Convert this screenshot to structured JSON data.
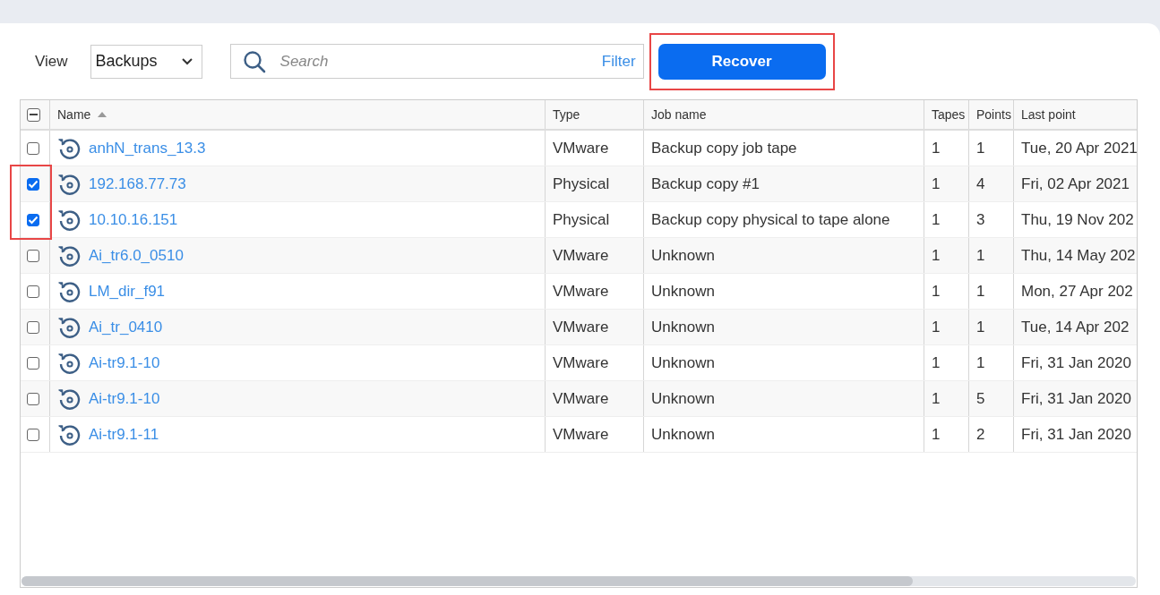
{
  "toolbar": {
    "view_label": "View",
    "view_select": "Backups",
    "search": {
      "placeholder": "Search"
    },
    "filter_link": "Filter",
    "recover_button": {
      "label": "Recover",
      "highlighted": true
    }
  },
  "table": {
    "select_all_partial": true,
    "columns": [
      {
        "label": "Name",
        "sorted_ascending": true
      },
      {
        "label": "Type",
        "sorted_ascending": false
      },
      {
        "label": "Job name",
        "sorted_ascending": false
      },
      {
        "label": "Tapes",
        "sorted_ascending": false
      },
      {
        "label": "Points",
        "sorted_ascending": false
      },
      {
        "label": "Last point",
        "sorted_ascending": false
      }
    ],
    "rows": [
      {
        "name": "anhN_trans_13.3",
        "type": "VMware",
        "job_name": "Backup copy job tape",
        "tapes": "1",
        "points": "1",
        "last_point": "Tue, 20 Apr 2021",
        "checked": false,
        "highlighted": false
      },
      {
        "name": "192.168.77.73",
        "type": "Physical",
        "job_name": "Backup copy #1",
        "tapes": "1",
        "points": "4",
        "last_point": "Fri, 02 Apr 2021",
        "checked": true,
        "highlighted": true
      },
      {
        "name": "10.10.16.151",
        "type": "Physical",
        "job_name": "Backup copy physical to tape alone",
        "tapes": "1",
        "points": "3",
        "last_point": "Thu, 19 Nov 202",
        "checked": true,
        "highlighted": true
      },
      {
        "name": "Ai_tr6.0_0510",
        "type": "VMware",
        "job_name": "Unknown",
        "tapes": "1",
        "points": "1",
        "last_point": "Thu, 14 May 202",
        "checked": false,
        "highlighted": false
      },
      {
        "name": "LM_dir_f91",
        "type": "VMware",
        "job_name": "Unknown",
        "tapes": "1",
        "points": "1",
        "last_point": "Mon, 27 Apr 202",
        "checked": false,
        "highlighted": false
      },
      {
        "name": "Ai_tr_0410",
        "type": "VMware",
        "job_name": "Unknown",
        "tapes": "1",
        "points": "1",
        "last_point": "Tue, 14 Apr 202",
        "checked": false,
        "highlighted": false
      },
      {
        "name": "Ai-tr9.1-10",
        "type": "VMware",
        "job_name": "Unknown",
        "tapes": "1",
        "points": "1",
        "last_point": "Fri, 31 Jan 2020",
        "checked": false,
        "highlighted": false
      },
      {
        "name": "Ai-tr9.1-10",
        "type": "VMware",
        "job_name": "Unknown",
        "tapes": "1",
        "points": "5",
        "last_point": "Fri, 31 Jan 2020",
        "checked": false,
        "highlighted": false
      },
      {
        "name": "Ai-tr9.1-11",
        "type": "VMware",
        "job_name": "Unknown",
        "tapes": "1",
        "points": "2",
        "last_point": "Fri, 31 Jan 2020",
        "checked": false,
        "highlighted": false
      }
    ]
  }
}
